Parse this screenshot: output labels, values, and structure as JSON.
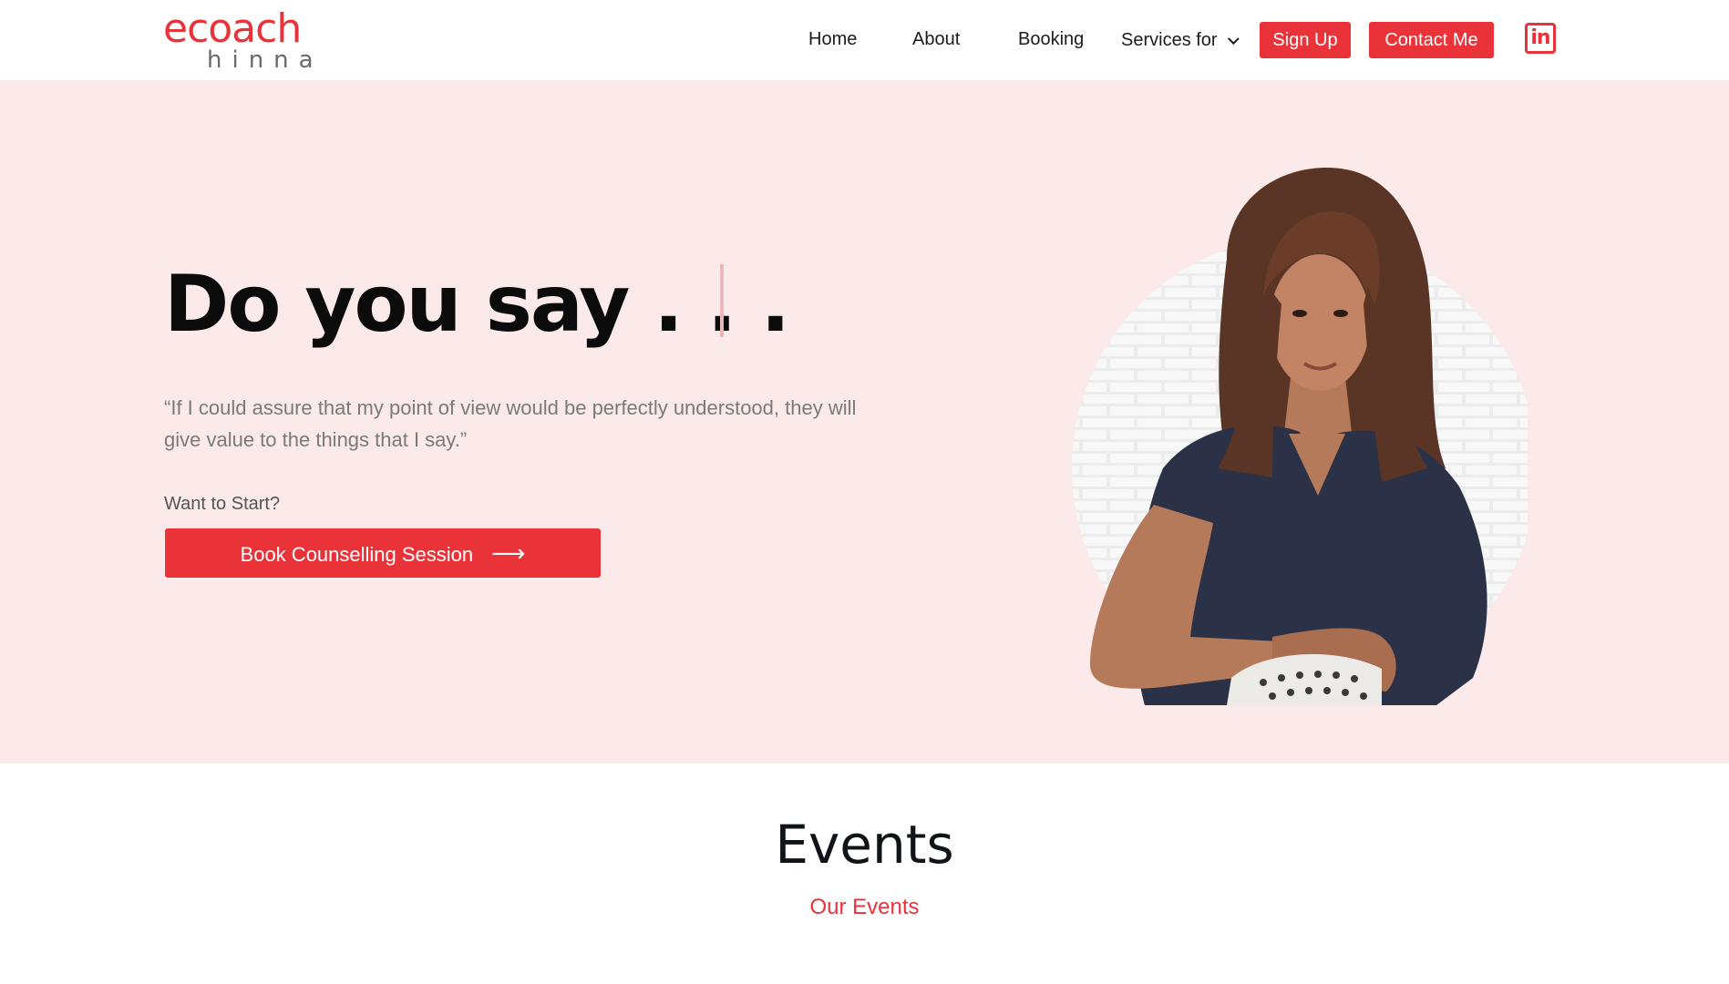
{
  "brand": {
    "logo_main": "ecoach",
    "logo_sub": "hinna",
    "accent_color": "#ea3338",
    "hero_bg": "#fceaea"
  },
  "nav": {
    "items": [
      {
        "label": "Home"
      },
      {
        "label": "About"
      },
      {
        "label": "Booking"
      },
      {
        "label": "Services for"
      }
    ],
    "signup_label": "Sign Up",
    "contact_label": "Contact Me",
    "social_icon": "linkedin-icon",
    "social_text": "in"
  },
  "hero": {
    "title": "Do you say . . .",
    "quote": "“If I could assure that my point of view would be perfectly understood, they will give value to the things that I say.”",
    "prompt": "Want to Start?",
    "cta_label": "Book Counselling Session",
    "cta_icon": "arrow-right-icon",
    "cta_arrow": "⟶"
  },
  "events": {
    "title": "Events",
    "subtitle": "Our Events"
  }
}
